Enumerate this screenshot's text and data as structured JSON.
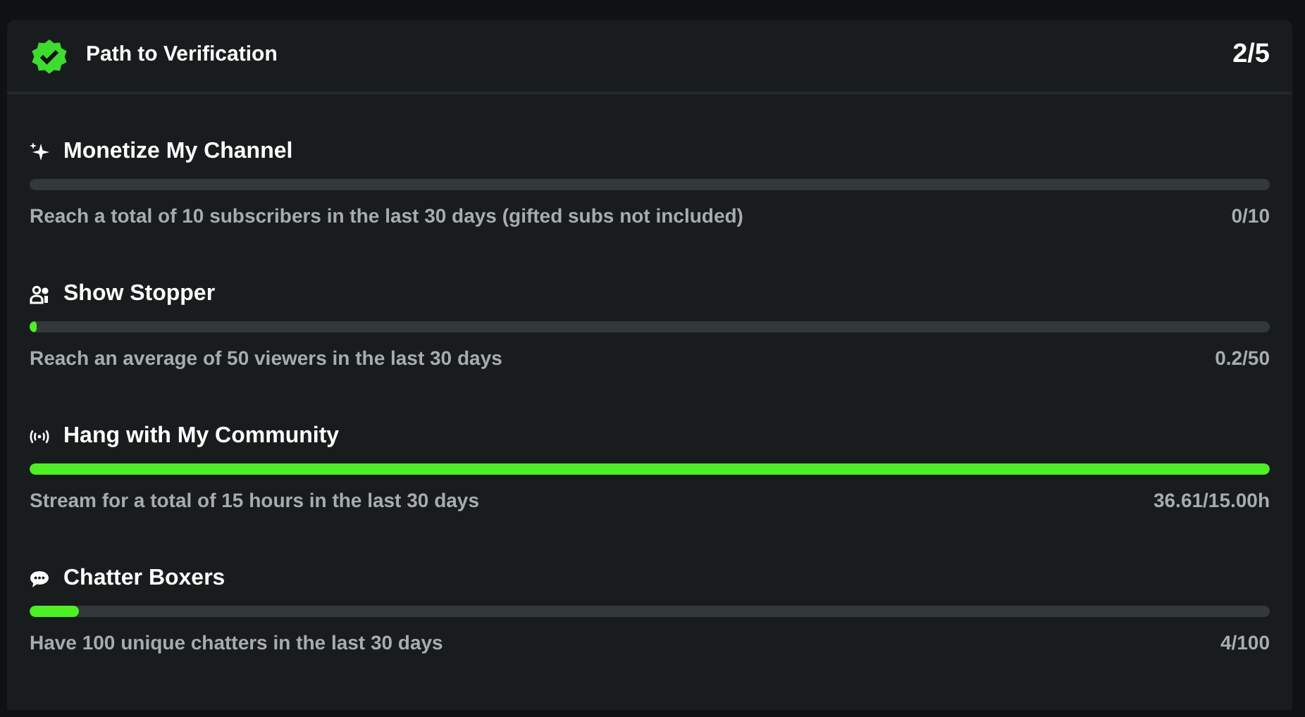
{
  "header": {
    "title": "Path to Verification",
    "progress": "2/5"
  },
  "goals": [
    {
      "title": "Monetize My Channel",
      "level": 0,
      "description": "Reach a total of 10 subscribers in the last 30 days (gifted subs not included)",
      "reading": "0/10"
    },
    {
      "title": "Show Stopper",
      "level": 0.006,
      "description": "Reach an average of 50 viewers in the last 30 days",
      "reading": "0.2/50"
    },
    {
      "title": "Hang with My Community",
      "level": 1,
      "description": "Stream for a total of 15 hours in the last 30 days",
      "reading": "36.61/15.00h"
    },
    {
      "title": "Chatter Boxers",
      "level": 0.04,
      "description": "Have 100 unique chatters in the last 30 days",
      "reading": "4/100"
    }
  ]
}
